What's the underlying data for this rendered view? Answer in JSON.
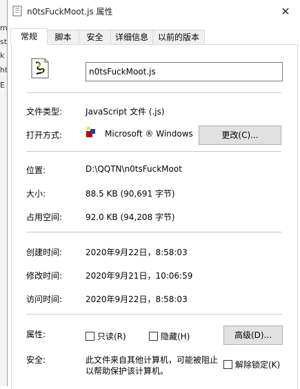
{
  "background_fragments": [
    "m",
    "st",
    "k",
    "ht",
    "E"
  ],
  "window": {
    "title": "n0tsFuckMoot.js 属性",
    "close_glyph": "✕"
  },
  "tabs": [
    "常规",
    "脚本",
    "安全",
    "详细信息",
    "以前的版本"
  ],
  "active_tab": "常规",
  "file": {
    "name": "n0tsFuckMoot.js"
  },
  "general": {
    "type_label": "文件类型:",
    "type_value": "JavaScript 文件 (.js)",
    "opens_label": "打开方式:",
    "opens_value": "Microsoft ® Windows",
    "change_button": "更改(C)...",
    "location_label": "位置:",
    "location_value": "D:\\QQTN\\n0tsFuckMoot",
    "size_label": "大小:",
    "size_value": "88.5 KB (90,691 字节)",
    "disk_label": "占用空间:",
    "disk_value": "92.0 KB (94,208 字节)",
    "created_label": "创建时间:",
    "created_value": "2020年9月22日，8:58:03",
    "modified_label": "修改时间:",
    "modified_value": "2020年9月21日，10:06:59",
    "accessed_label": "访问时间:",
    "accessed_value": "2020年9月22日，8:58:03",
    "attributes_label": "属性:",
    "readonly_label": "只读(R)",
    "hidden_label": "隐藏(H)",
    "advanced_button": "高级(D)...",
    "security_label": "安全:",
    "security_text_1": "此文件来自其他计算机，可能被阻止",
    "security_text_2": "以帮助保护该计算机。",
    "unblock_label": "解除锁定(K)"
  },
  "colors": {
    "panel_border": "#d9d9d9",
    "button_face": "#e1e1e1"
  }
}
